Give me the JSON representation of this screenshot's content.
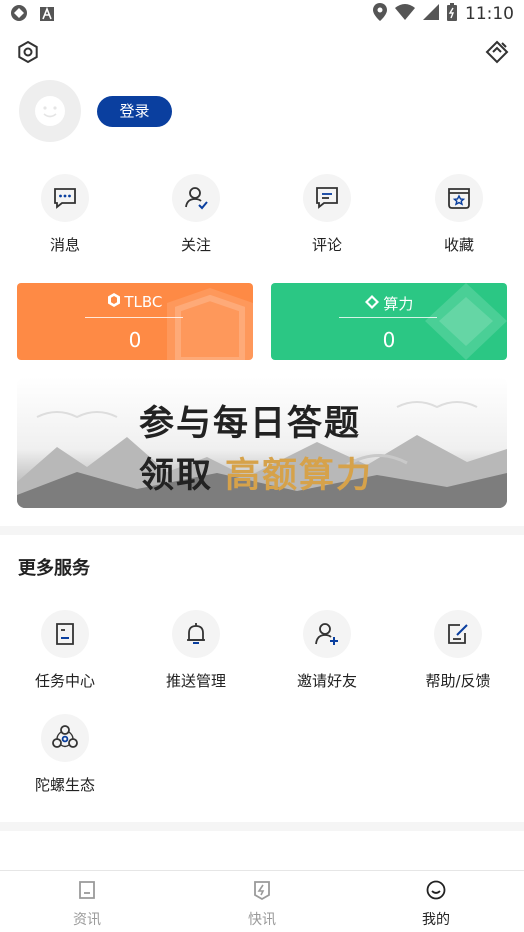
{
  "status_bar": {
    "time": "11:10"
  },
  "profile": {
    "login_label": "登录"
  },
  "quick_actions": [
    {
      "label": "消息",
      "icon": "message-icon"
    },
    {
      "label": "关注",
      "icon": "follow-user-icon"
    },
    {
      "label": "评论",
      "icon": "comment-icon"
    },
    {
      "label": "收藏",
      "icon": "favorite-box-icon"
    }
  ],
  "cards": [
    {
      "title": "TLBC",
      "value": "0",
      "color": "#fe8a45"
    },
    {
      "title": "算力",
      "value": "0",
      "color": "#2bc784"
    }
  ],
  "banner": {
    "line1": "参与每日答题",
    "line2a": "领取",
    "line2b": "高额算力"
  },
  "services": {
    "title": "更多服务",
    "items": [
      {
        "label": "任务中心",
        "icon": "task-icon"
      },
      {
        "label": "推送管理",
        "icon": "bell-icon"
      },
      {
        "label": "邀请好友",
        "icon": "invite-friend-icon"
      },
      {
        "label": "帮助/反馈",
        "icon": "feedback-icon"
      },
      {
        "label": "陀螺生态",
        "icon": "ecosystem-icon"
      }
    ]
  },
  "tabbar": {
    "tabs": [
      {
        "label": "资讯",
        "icon": "news-icon",
        "active": false
      },
      {
        "label": "快讯",
        "icon": "flash-news-icon",
        "active": false
      },
      {
        "label": "我的",
        "icon": "me-icon",
        "active": true
      }
    ]
  },
  "colors": {
    "accent": "#0a3f9f",
    "orange": "#fe8a45",
    "green": "#2bc784",
    "inactive_tab": "#9a9a9a"
  }
}
